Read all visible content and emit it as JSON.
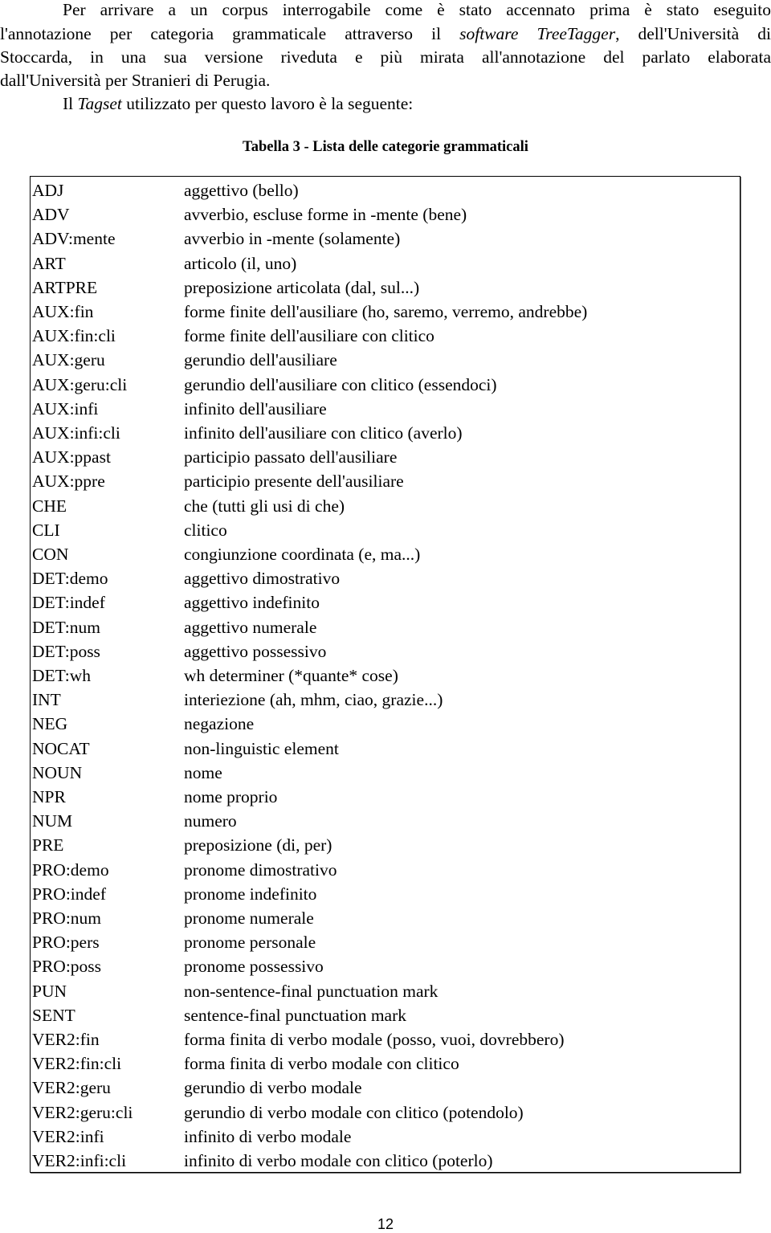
{
  "paragraph": {
    "line1": "Per arrivare a un corpus interrogabile come è stato accennato prima è stato eseguito",
    "line2_a": "l'annotazione per categoria grammaticale attraverso il",
    "line2_italic": "software TreeTagger",
    "line2_b": ", dell'Università di",
    "line3": "Stoccarda, in una sua versione riveduta e più mirata all'annotazione del parlato elaborata",
    "line4": "dall'Università per Stranieri di Perugia.",
    "line5_a": "Il",
    "line5_italic": "Tagset",
    "line5_b": "utilizzato per questo lavoro è la seguente:"
  },
  "table": {
    "caption": "Tabella 3 - Lista delle categorie grammaticali",
    "rows": [
      [
        "ADJ",
        "aggettivo (bello)"
      ],
      [
        "ADV",
        "avverbio, escluse forme in -mente (bene)"
      ],
      [
        "ADV:mente",
        "avverbio in -mente (solamente)"
      ],
      [
        "ART",
        "articolo (il, uno)"
      ],
      [
        "ARTPRE",
        "preposizione articolata (dal, sul...)"
      ],
      [
        "AUX:fin",
        "forme finite dell'ausiliare (ho, saremo, verremo, andrebbe)"
      ],
      [
        "AUX:fin:cli",
        "forme finite dell'ausiliare con clitico"
      ],
      [
        "AUX:geru",
        "gerundio dell'ausiliare"
      ],
      [
        "AUX:geru:cli",
        "gerundio dell'ausiliare con clitico (essendoci)"
      ],
      [
        "AUX:infi",
        "infinito dell'ausiliare"
      ],
      [
        "AUX:infi:cli",
        "infinito dell'ausiliare con clitico (averlo)"
      ],
      [
        "AUX:ppast",
        "participio passato dell'ausiliare"
      ],
      [
        "AUX:ppre",
        "participio presente dell'ausiliare"
      ],
      [
        "CHE",
        "che (tutti gli usi di che)"
      ],
      [
        "CLI",
        "clitico"
      ],
      [
        "CON",
        "congiunzione coordinata (e, ma...)"
      ],
      [
        "DET:demo",
        "aggettivo dimostrativo"
      ],
      [
        "DET:indef",
        "aggettivo indefinito"
      ],
      [
        "DET:num",
        "aggettivo numerale"
      ],
      [
        "DET:poss",
        "aggettivo possessivo"
      ],
      [
        "DET:wh",
        "wh determiner (*quante* cose)"
      ],
      [
        "INT",
        "interiezione (ah, mhm, ciao, grazie...)"
      ],
      [
        "NEG",
        "negazione"
      ],
      [
        "NOCAT",
        "non-linguistic element"
      ],
      [
        "NOUN",
        "nome"
      ],
      [
        "NPR",
        "nome proprio"
      ],
      [
        "NUM",
        "numero"
      ],
      [
        "PRE",
        "preposizione (di, per)"
      ],
      [
        "PRO:demo",
        "pronome dimostrativo"
      ],
      [
        "PRO:indef",
        "pronome indefinito"
      ],
      [
        "PRO:num",
        "pronome numerale"
      ],
      [
        "PRO:pers",
        "pronome personale"
      ],
      [
        "PRO:poss",
        "pronome possessivo"
      ],
      [
        "PUN",
        "non-sentence-final punctuation mark"
      ],
      [
        "SENT",
        "sentence-final punctuation mark"
      ],
      [
        "VER2:fin",
        "forma finita di verbo modale (posso, vuoi, dovrebbero)"
      ],
      [
        "VER2:fin:cli",
        "forma finita di verbo modale con clitico"
      ],
      [
        "VER2:geru",
        "gerundio di verbo modale"
      ],
      [
        "VER2:geru:cli",
        "gerundio di verbo modale con clitico (potendolo)"
      ],
      [
        "VER2:infi",
        "infinito di verbo modale"
      ],
      [
        "VER2:infi:cli",
        "infinito di verbo modale con clitico (poterlo)"
      ]
    ]
  },
  "page_number": "12"
}
